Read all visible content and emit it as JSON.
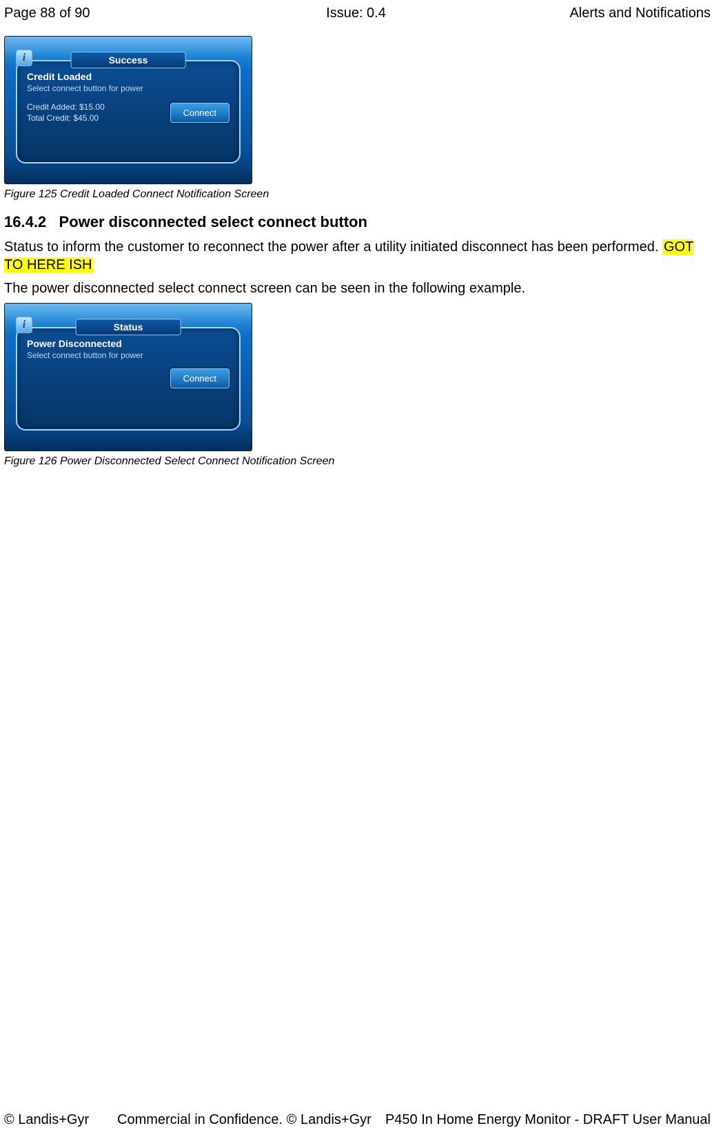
{
  "header": {
    "page": "Page 88 of 90",
    "issue": "Issue: 0.4",
    "section": "Alerts and Notifications"
  },
  "screen1": {
    "info_glyph": "i",
    "title": "Success",
    "heading": "Credit Loaded",
    "sub": "Select connect button for power",
    "line1": "Credit Added: $15.00",
    "line2": "Total Credit: $45.00",
    "button": "Connect"
  },
  "caption1": "Figure 125 Credit Loaded Connect Notification Screen",
  "section_num": "16.4.2",
  "section_title": "Power disconnected select connect button",
  "para1_a": "Status to inform the customer to reconnect the power after a utility initiated disconnect has been performed. ",
  "para1_highlight": "GOT TO HERE ISH",
  "para2": "The power disconnected select connect screen can be seen in the following example.",
  "screen2": {
    "info_glyph": "i",
    "title": "Status",
    "heading": "Power Disconnected",
    "sub": "Select connect button for power",
    "button": "Connect"
  },
  "caption2": "Figure 126 Power Disconnected Select Connect Notification Screen",
  "footer": {
    "left": "© Landis+Gyr",
    "center": "Commercial in Confidence. © Landis+Gyr",
    "right": "P450 In Home Energy Monitor - DRAFT User Manual"
  }
}
